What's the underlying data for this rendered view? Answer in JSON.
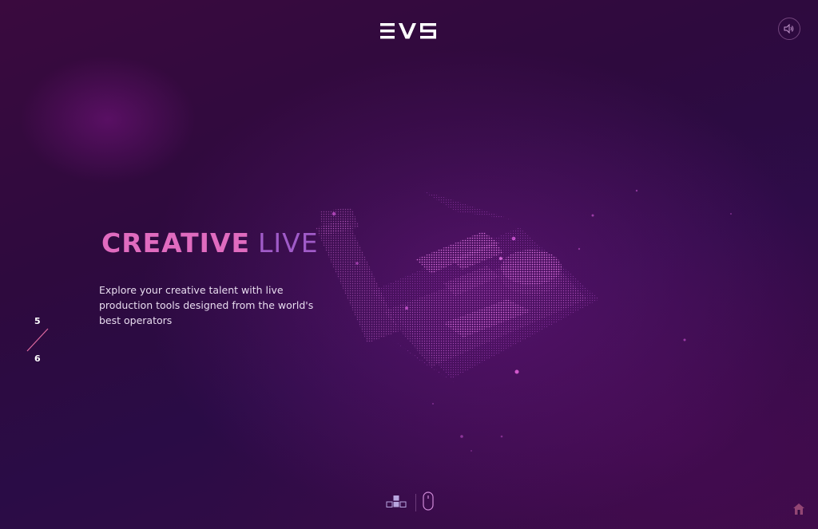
{
  "brand": {
    "logo_text": "EVS"
  },
  "header": {
    "sound_icon": "speaker-icon"
  },
  "hero": {
    "title_strong": "CREATIVE",
    "title_light": "LIVE",
    "description": "Explore your creative talent with live production tools designed from the world's best operators"
  },
  "pager": {
    "current": "5",
    "total": "6"
  },
  "bottom": {
    "nav_icon": "blocks-icon",
    "scroll_icon": "mouse-icon"
  },
  "corner": {
    "icon": "home-icon"
  },
  "colors": {
    "accent_pink": "#e06bbf",
    "accent_purple": "#a05bc8",
    "text": "#e8dcef"
  }
}
